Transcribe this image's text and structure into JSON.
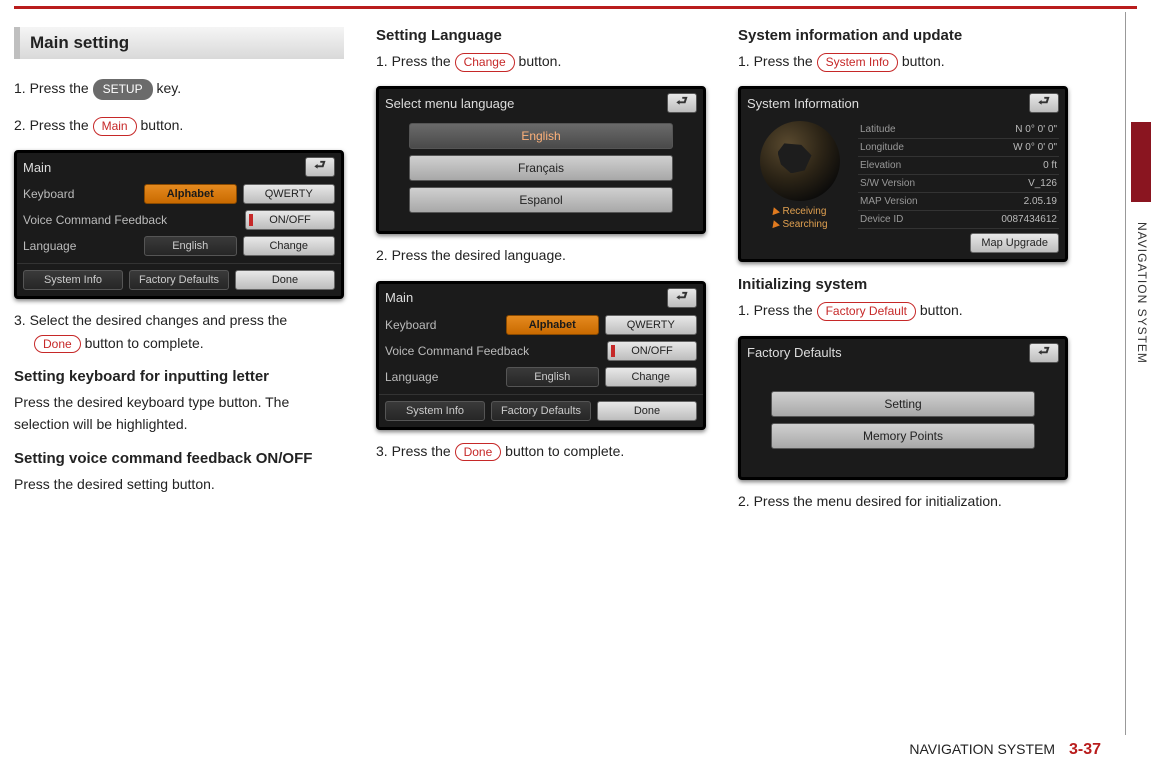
{
  "page": {
    "footer_section": "NAVIGATION SYSTEM",
    "page_number": "3-37",
    "side_tab": "NAVIGATION SYSTEM"
  },
  "col1": {
    "title": "Main setting",
    "step1_a": "1. Press the ",
    "step1_key": "SETUP",
    "step1_b": " key.",
    "step2_a": "2. Press the ",
    "step2_btn": "Main",
    "step2_b": " button.",
    "shot_main": {
      "title": "Main",
      "rows": {
        "keyboard_label": "Keyboard",
        "alphabet": "Alphabet",
        "qwerty": "QWERTY",
        "voice_label": "Voice Command Feedback",
        "onoff": "ON/OFF",
        "lang_label": "Language",
        "lang_val": "English",
        "change": "Change"
      },
      "bottom": {
        "sysinfo": "System Info",
        "factory": "Factory Defaults",
        "done": "Done"
      }
    },
    "step3_a": "3. Select the desired changes and press the ",
    "step3_btn": "Done",
    "step3_b": " button to complete.",
    "sub1_title": "Setting keyboard for inputting letter",
    "sub1_body": "Press the desired keyboard type button. The selection will be highlighted.",
    "sub2_title": "Setting voice command feedback ON/OFF",
    "sub2_body": "Press the desired setting button."
  },
  "col2": {
    "title": "Setting Language",
    "step1_a": "1. Press the ",
    "step1_btn": "Change",
    "step1_b": "  button.",
    "shot_lang": {
      "title": "Select menu language",
      "opt1": "English",
      "opt2": "Français",
      "opt3": "Espanol"
    },
    "step2": "2. Press the desired language.",
    "step3_a": "3. Press the ",
    "step3_btn": "Done",
    "step3_b": " button to complete."
  },
  "col3": {
    "title1": "System information and update",
    "step1_a": "1. Press the ",
    "step1_btn": "System Info",
    "step1_b": " button.",
    "shot_sys": {
      "title": "System Information",
      "gps1": "Receiving",
      "gps2": "Searching",
      "rows": {
        "lat_l": "Latitude",
        "lat_v": "N   0° 0' 0\"",
        "lon_l": "Longitude",
        "lon_v": "W   0° 0' 0\"",
        "elev_l": "Elevation",
        "elev_v": "0 ft",
        "sw_l": "S/W Version",
        "sw_v": "V_126",
        "map_l": "MAP Version",
        "map_v": "2.05.19",
        "dev_l": "Device ID",
        "dev_v": "0087434612"
      },
      "map_upgrade": "Map Upgrade"
    },
    "title2": "Initializing system",
    "step_i1_a": "1. Press the ",
    "step_i1_btn": "Factory Default",
    "step_i1_b": "  button.",
    "shot_factory": {
      "title": "Factory Defaults",
      "opt1": "Setting",
      "opt2": "Memory Points"
    },
    "step_i2": "2. Press the menu desired for initialization."
  }
}
